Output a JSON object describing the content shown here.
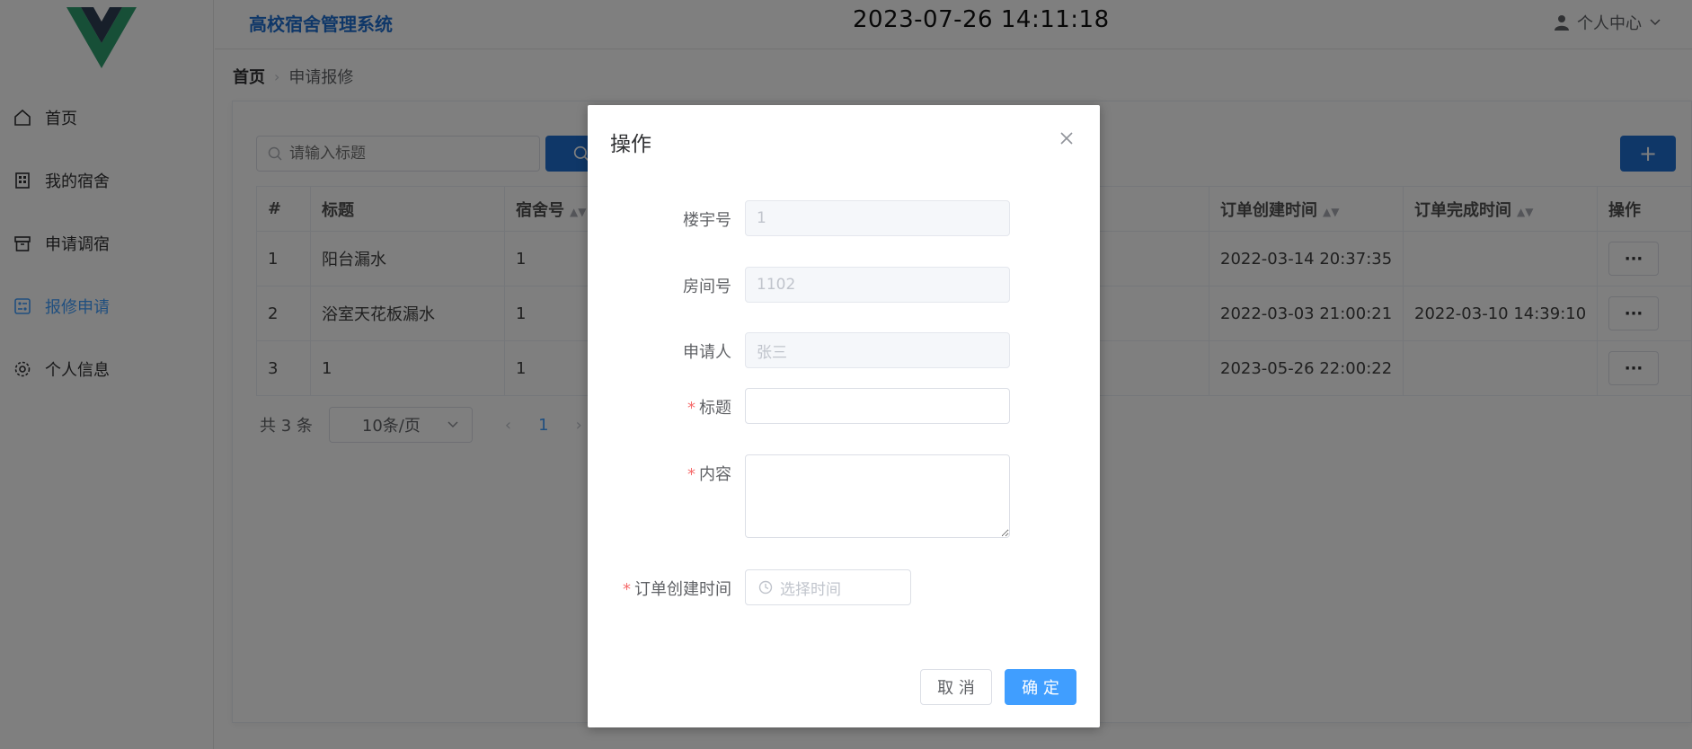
{
  "app": {
    "title": "高校宿舍管理系统",
    "clock": "2023-07-26 14:11:18",
    "user_center": "个人中心"
  },
  "sidebar": {
    "items": [
      {
        "label": "首页",
        "icon": "home-icon"
      },
      {
        "label": "我的宿舍",
        "icon": "building-icon"
      },
      {
        "label": "申请调宿",
        "icon": "box-icon"
      },
      {
        "label": "报修申请",
        "icon": "tickets-icon",
        "active": true
      },
      {
        "label": "个人信息",
        "icon": "gear-icon"
      }
    ]
  },
  "breadcrumb": {
    "home": "首页",
    "current": "申请报修"
  },
  "search": {
    "placeholder": "请输入标题"
  },
  "table": {
    "headers": [
      "#",
      "标题",
      "宿舍号",
      "订单创建时间",
      "订单完成时间",
      "操作"
    ],
    "rows": [
      {
        "idx": "1",
        "title": "阳台漏水",
        "room": "1",
        "created": "2022-03-14 20:37:35",
        "finished": ""
      },
      {
        "idx": "2",
        "title": "浴室天花板漏水",
        "room": "1",
        "created": "2022-03-03 21:00:21",
        "finished": "2022-03-10 14:39:10"
      },
      {
        "idx": "3",
        "title": "1",
        "room": "1",
        "created": "2023-05-26 22:00:22",
        "finished": ""
      }
    ],
    "op_label": "···"
  },
  "pager": {
    "total": "共 3 条",
    "size": "10条/页",
    "page": "1"
  },
  "dialog": {
    "title": "操作",
    "fields": {
      "building": {
        "label": "楼宇号",
        "value": "1"
      },
      "room": {
        "label": "房间号",
        "value": "1102"
      },
      "applicant": {
        "label": "申请人",
        "value": "张三"
      },
      "title": {
        "label": "标题",
        "value": ""
      },
      "content": {
        "label": "内容"
      },
      "created_time": {
        "label": "订单创建时间",
        "placeholder": "选择时间"
      }
    },
    "cancel": "取 消",
    "confirm": "确 定"
  },
  "colors": {
    "primary": "#409eff",
    "brand": "#1f6fd1",
    "required": "#f56c6c"
  }
}
